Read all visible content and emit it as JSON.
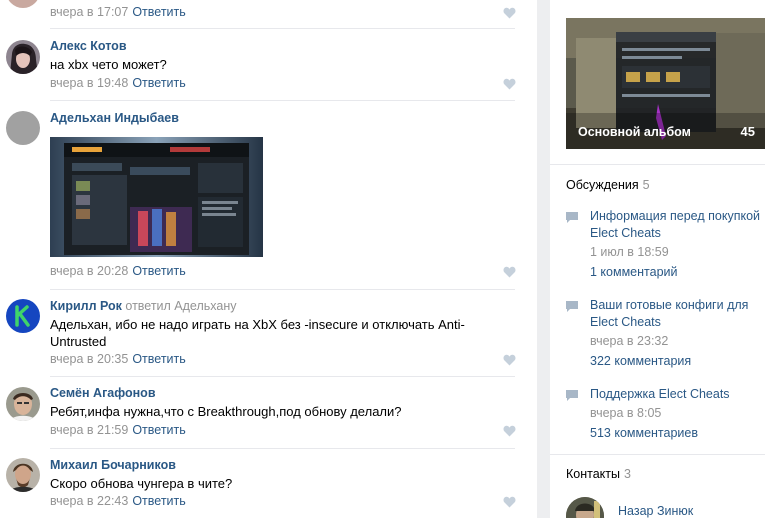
{
  "comments": [
    {
      "author": "",
      "text": "",
      "date": "вчера в 17:07",
      "reply": "Ответить"
    },
    {
      "author": "Алекс Котов",
      "text": "на xbx чето может?",
      "date": "вчера в 19:48",
      "reply": "Ответить"
    },
    {
      "author": "Адельхан Индыбаев",
      "text": "",
      "date": "вчера в 20:28",
      "reply": "Ответить"
    },
    {
      "author": "Кирилл Рок",
      "reply_to": "ответил Адельхану",
      "text": "Адельхан, ибо не надо играть на XbX без -insecure и отключать Anti-Untrusted",
      "date": "вчера в 20:35",
      "reply": "Ответить"
    },
    {
      "author": "Семён Агафонов",
      "text": "Ребят,инфа нужна,что с Breakthrough,под обнову делали?",
      "date": "вчера в 21:59",
      "reply": "Ответить"
    },
    {
      "author": "Михаил Бочарников",
      "text": "Скоро обнова чунгера в чите?",
      "date": "вчера в 22:43",
      "reply": "Ответить"
    }
  ],
  "sidebar": {
    "album": {
      "label": "Основной альбом",
      "count": "45"
    },
    "discussions": {
      "title": "Обсуждения",
      "count": "5",
      "topics": [
        {
          "title": "Информация перед покупкой Elect Cheats",
          "date": "1 июл в 18:59",
          "comments": "1 комментарий"
        },
        {
          "title": "Ваши готовые конфиги для Elect Cheats",
          "date": "вчера в 23:32",
          "comments": "322 комментария"
        },
        {
          "title": "Поддержка Elect Cheats",
          "date": "вчера в 8:05",
          "comments": "513 комментариев"
        }
      ]
    },
    "contacts": {
      "title": "Контакты",
      "count": "3",
      "items": [
        {
          "name": "Назар Зинюк"
        }
      ]
    }
  },
  "colors": {
    "link": "#2a5885",
    "meta": "#939393",
    "background": "#edeef0",
    "separator": "#e7e8ec"
  }
}
